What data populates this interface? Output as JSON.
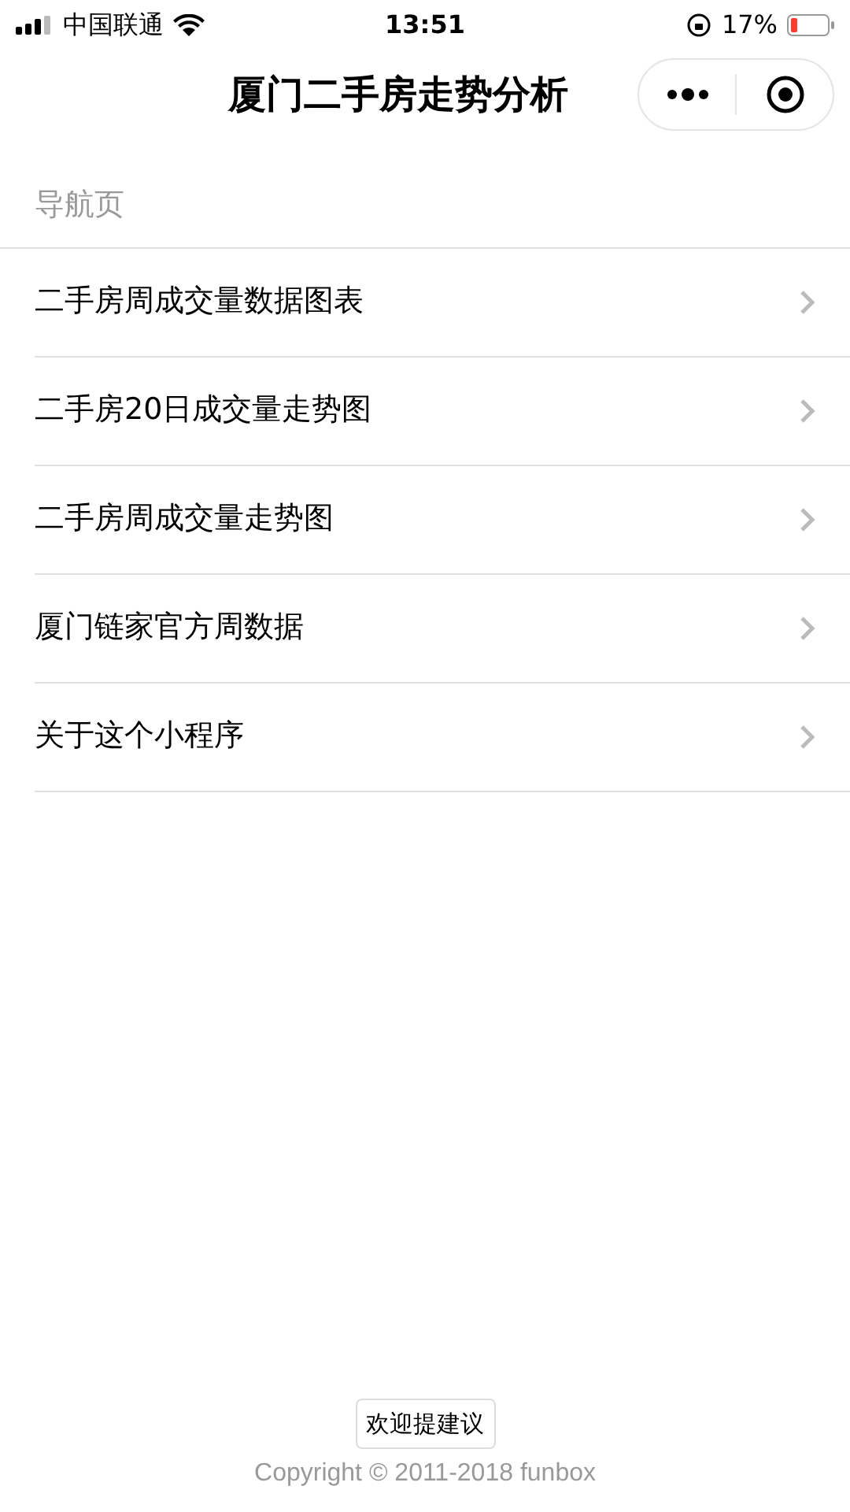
{
  "status_bar": {
    "carrier": "中国联通",
    "time": "13:51",
    "battery": "17%"
  },
  "nav_bar": {
    "title": "厦门二手房走势分析"
  },
  "section": {
    "title": "导航页"
  },
  "items": [
    {
      "label": "二手房周成交量数据图表"
    },
    {
      "label": "二手房20日成交量走势图"
    },
    {
      "label": "二手房周成交量走势图"
    },
    {
      "label": "厦门链家官方周数据"
    },
    {
      "label": "关于这个小程序"
    }
  ],
  "footer": {
    "button": "欢迎提建议",
    "copyright": "Copyright © 2011-2018 funbox"
  }
}
